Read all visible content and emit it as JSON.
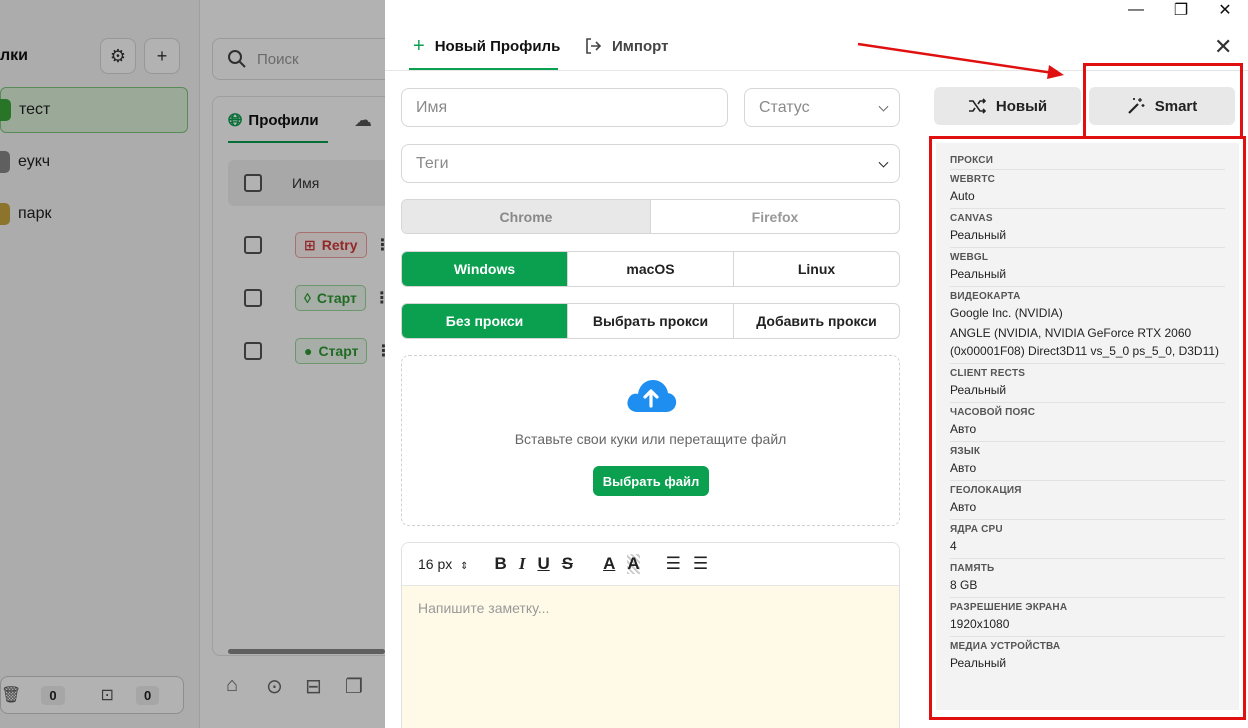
{
  "window": {
    "minimize": "—",
    "restore": "❐",
    "close": "✕"
  },
  "sidebar": {
    "title": "лки",
    "items": [
      {
        "label": "тест",
        "color": "#3aa83a"
      },
      {
        "label": "еукч",
        "color": "#888888"
      },
      {
        "label": "парк",
        "color": "#c9a640"
      }
    ],
    "bottom_counts": [
      "0",
      "0"
    ]
  },
  "background": {
    "search_placeholder": "Поиск",
    "tab_profiles": "Профили",
    "column_name": "Имя",
    "rows": [
      {
        "action": "Retry",
        "kind": "red",
        "icon": "windows-icon"
      },
      {
        "action": "Старт",
        "kind": "green",
        "icon": "linux-icon"
      },
      {
        "action": "Старт",
        "kind": "green",
        "icon": "apple-icon"
      }
    ]
  },
  "modal": {
    "tabs": {
      "new_profile": "Новый Профиль",
      "import": "Импорт"
    },
    "name_placeholder": "Имя",
    "status_placeholder": "Статус",
    "tags_placeholder": "Теги",
    "browsers": [
      "Chrome",
      "Firefox"
    ],
    "os": [
      "Windows",
      "macOS",
      "Linux"
    ],
    "proxy": [
      "Без прокси",
      "Выбрать прокси",
      "Добавить прокси"
    ],
    "dropzone": {
      "text": "Вставьте свои куки или перетащите файл",
      "button": "Выбрать файл"
    },
    "editor": {
      "font_size": "16 px",
      "placeholder": "Напишите заметку..."
    }
  },
  "fingerprint": {
    "new_button": "Новый",
    "smart_button": "Smart",
    "specs": [
      {
        "label": "ПРОКСИ",
        "value": ""
      },
      {
        "label": "WEBRTC",
        "value": "Auto"
      },
      {
        "label": "CANVAS",
        "value": "Реальный"
      },
      {
        "label": "WEBGL",
        "value": "Реальный"
      },
      {
        "label": "ВИДЕОКАРТА",
        "value": "Google Inc. (NVIDIA)\nANGLE (NVIDIA, NVIDIA GeForce RTX 2060 (0x00001F08) Direct3D11 vs_5_0 ps_5_0, D3D11)"
      },
      {
        "label": "CLIENT RECTS",
        "value": "Реальный"
      },
      {
        "label": "ЧАСОВОЙ ПОЯС",
        "value": "Авто"
      },
      {
        "label": "ЯЗЫК",
        "value": "Авто"
      },
      {
        "label": "ГЕОЛОКАЦИЯ",
        "value": "Авто"
      },
      {
        "label": "ЯДРА CPU",
        "value": "4"
      },
      {
        "label": "ПАМЯТЬ",
        "value": "8 GB"
      },
      {
        "label": "РАЗРЕШЕНИЕ ЭКРАНА",
        "value": "1920x1080"
      },
      {
        "label": "МЕДИА УСТРОЙСТВА",
        "value": "Реальный"
      }
    ]
  },
  "colors": {
    "accent": "#0aa050",
    "annotation": "#e01010"
  }
}
